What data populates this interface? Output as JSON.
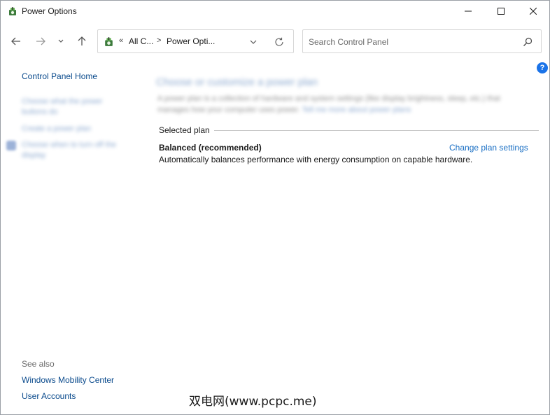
{
  "window": {
    "title": "Power Options",
    "app_icon": "power-options-icon"
  },
  "caption_buttons": {
    "minimize_icon": "minimize-icon",
    "maximize_icon": "maximize-icon",
    "close_icon": "close-icon"
  },
  "nav": {
    "back_icon": "arrow-left-icon",
    "forward_icon": "arrow-right-icon",
    "recent_icon": "chevron-down-icon",
    "up_icon": "arrow-up-icon"
  },
  "address": {
    "overflow": "«",
    "segments": [
      "All C...",
      "Power Opti..."
    ],
    "separator": ">",
    "dropdown_icon": "chevron-down-icon",
    "refresh_icon": "refresh-icon"
  },
  "search": {
    "placeholder": "Search Control Panel",
    "value": "",
    "icon": "search-icon"
  },
  "help": {
    "label": "?"
  },
  "sidebar": {
    "home_link": "Control Panel Home",
    "blurred_links": [
      "Choose what the power",
      "buttons do",
      "Create a power plan",
      "Choose when to turn off the",
      "display"
    ],
    "see_also_heading": "See also",
    "see_also_links": [
      "Windows Mobility Center",
      "User Accounts"
    ]
  },
  "main": {
    "heading": "Choose or customize a power plan",
    "description_line1": "A power plan is a collection of hardware and system settings (like display brightness, sleep, etc.) that",
    "description_line2": "manages how your computer uses power.",
    "description_link": "Tell me more about power plans",
    "section_label": "Selected plan",
    "plan": {
      "name": "Balanced (recommended)",
      "change_link": "Change plan settings",
      "description": "Automatically balances performance with energy consumption on capable hardware."
    }
  },
  "watermark": "双电网(www.pcpc.me)",
  "colors": {
    "link": "#0a4a8c",
    "accent_link": "#1a6fc4",
    "help_badge": "#1a73e8"
  }
}
